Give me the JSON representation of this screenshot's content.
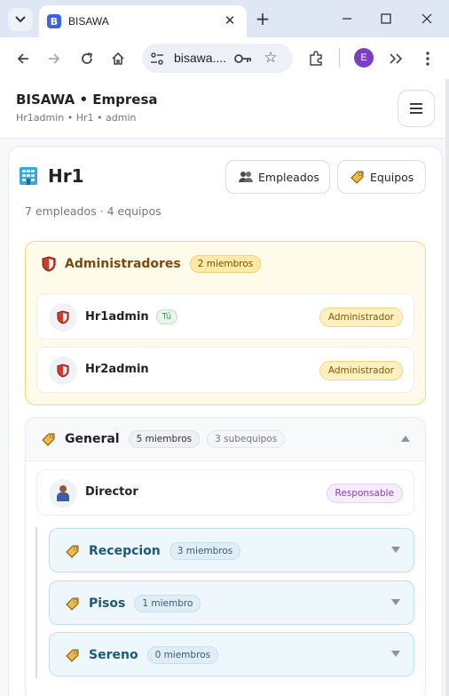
{
  "browser": {
    "tab_title": "BISAWA",
    "favicon_letter": "B",
    "url_display": "bisawa....",
    "profile_initial": "E",
    "icons": [
      "tab-search-icon",
      "close-icon",
      "new-tab-icon",
      "minimize-icon",
      "maximize-icon",
      "window-close-icon",
      "back-icon",
      "forward-icon",
      "reload-icon",
      "home-icon",
      "site-settings-icon",
      "key-icon",
      "star-icon",
      "extensions-icon",
      "more-tools-icon",
      "kebab-menu-icon"
    ]
  },
  "app": {
    "title": "BISAWA • Empresa",
    "subtitle": "Hr1admin • Hr1 • admin"
  },
  "team": {
    "name": "Hr1",
    "stats": "7 empleados · 4 equipos",
    "buttons": {
      "employees": "Empleados",
      "teams": "Equipos"
    }
  },
  "admins": {
    "title": "Administradores",
    "count": "2 miembros",
    "members": [
      {
        "name": "Hr1admin",
        "you_badge": "Tú",
        "role": "Administrador"
      },
      {
        "name": "Hr2admin",
        "role": "Administrador"
      }
    ]
  },
  "general": {
    "title": "General",
    "members_count": "5 miembros",
    "subteams_count": "3 subequipos",
    "leader": {
      "name": "Director",
      "role": "Responsable"
    },
    "subteams": [
      {
        "name": "Recepcion",
        "count": "3 miembros"
      },
      {
        "name": "Pisos",
        "count": "1 miembro"
      },
      {
        "name": "Sereno",
        "count": "0 miembros"
      }
    ]
  },
  "colors": {
    "admin_bg": "#fffbea",
    "admin_border": "#f4d777",
    "admin_title": "#7a4a10",
    "subteam_bg": "#eef7fc",
    "subteam_border": "#bfe0f0",
    "subteam_title": "#1b5a78",
    "responsable_badge": "#8a3fb6",
    "you_badge": "#2da44e"
  }
}
